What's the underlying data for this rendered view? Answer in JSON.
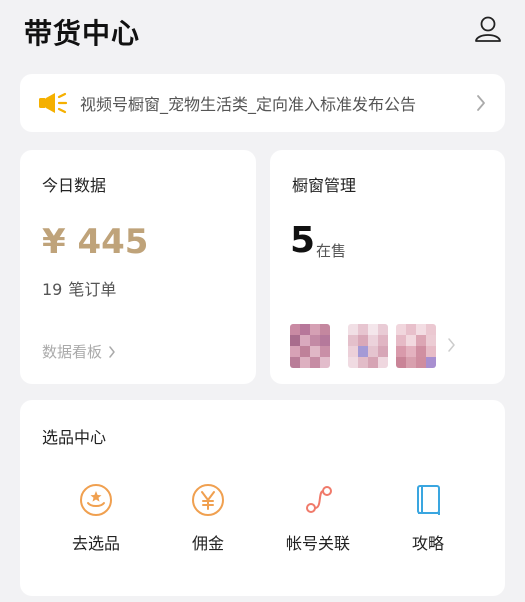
{
  "header": {
    "title": "带货中心",
    "profile_icon": "user-icon"
  },
  "notice": {
    "text": "视频号橱窗_宠物生活类_定向准入标准发布公告",
    "icon": "speaker-icon",
    "accent": "#f5b000"
  },
  "today": {
    "title": "今日数据",
    "amount": "¥ 445",
    "orders_count": "19",
    "orders_label": "笔订单",
    "dashboard_link": "数据看板",
    "accent": "#bfa37a"
  },
  "window_mgmt": {
    "title": "橱窗管理",
    "count": "5",
    "count_label": "在售"
  },
  "selection": {
    "title": "选品中心",
    "items": [
      {
        "label": "去选品",
        "icon": "select-product-icon"
      },
      {
        "label": "佣金",
        "icon": "commission-yen-icon"
      },
      {
        "label": "帐号关联",
        "icon": "account-link-icon"
      },
      {
        "label": "攻略",
        "icon": "guide-book-icon"
      }
    ],
    "colors": {
      "orange": "#f0a050",
      "coral": "#f07a6a",
      "blue": "#3aa6e0"
    }
  }
}
